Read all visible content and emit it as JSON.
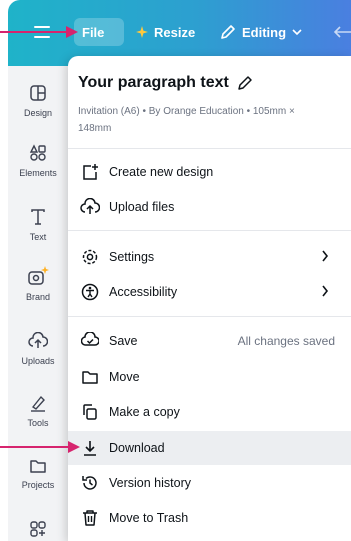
{
  "topbar": {
    "file_label": "File",
    "resize_label": "Resize",
    "editing_label": "Editing"
  },
  "sidebar": {
    "items": [
      {
        "label": "Design",
        "icon": "design-icon"
      },
      {
        "label": "Elements",
        "icon": "elements-icon"
      },
      {
        "label": "Text",
        "icon": "text-icon"
      },
      {
        "label": "Brand",
        "icon": "brand-icon"
      },
      {
        "label": "Uploads",
        "icon": "uploads-icon"
      },
      {
        "label": "Tools",
        "icon": "tools-icon"
      },
      {
        "label": "Projects",
        "icon": "projects-icon"
      }
    ]
  },
  "file_menu": {
    "title": "Your paragraph text",
    "meta": "Invitation (A6) • By Orange Education • 105mm × 148mm",
    "items": [
      {
        "label": "Create new design",
        "icon": "create-new-design-icon"
      },
      {
        "label": "Upload files",
        "icon": "upload-cloud-icon"
      },
      {
        "label": "Settings",
        "icon": "settings-gear-icon"
      },
      {
        "label": "Accessibility",
        "icon": "accessibility-icon"
      },
      {
        "label": "Save",
        "icon": "save-check-icon",
        "aside": "All changes saved"
      },
      {
        "label": "Move",
        "icon": "folder-icon"
      },
      {
        "label": "Make a copy",
        "icon": "copy-icon"
      },
      {
        "label": "Download",
        "icon": "download-icon"
      },
      {
        "label": "Version history",
        "icon": "version-history-icon"
      },
      {
        "label": "Move to Trash",
        "icon": "trash-icon"
      }
    ]
  },
  "colors": {
    "topbar_start": "#1fb3c9",
    "topbar_end": "#4a7fe0",
    "arrow": "#d6246e"
  }
}
